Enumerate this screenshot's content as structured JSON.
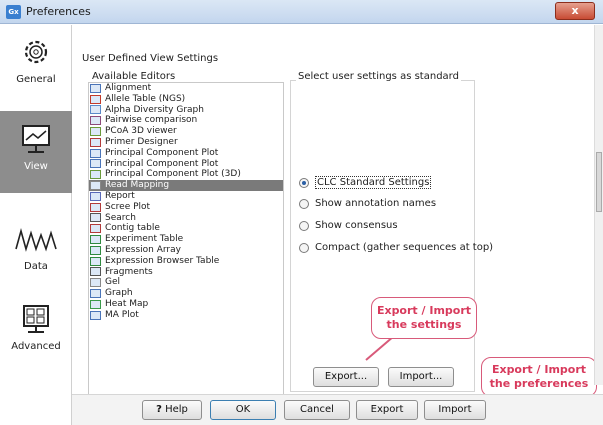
{
  "window": {
    "title": "Preferences",
    "app_icon": "Gx",
    "close_glyph": "x"
  },
  "nav": {
    "items": [
      {
        "label": "General",
        "icon": "gear-icon"
      },
      {
        "label": "View",
        "icon": "monitor-icon",
        "active": true
      },
      {
        "label": "Data",
        "icon": "data-wave-icon"
      },
      {
        "label": "Advanced",
        "icon": "checklist-icon"
      }
    ]
  },
  "content": {
    "section_title": "User Defined View Settings",
    "editors_label": "Available Editors",
    "editors": [
      "Alignment",
      "Allele Table (NGS)",
      "Alpha Diversity Graph",
      "Pairwise comparison",
      "PCoA 3D viewer",
      "Primer Designer",
      "Principal Component Plot",
      "Principal Component Plot",
      "Principal Component Plot (3D)",
      "Read Mapping",
      "Report",
      "Scree Plot",
      "Search",
      "Contig table",
      "Experiment Table",
      "Expression Array",
      "Expression Browser Table",
      "Fragments",
      "Gel",
      "Graph",
      "Heat Map",
      "MA Plot"
    ],
    "selected_editor_index": 9,
    "settings_title": "Select user settings as standard",
    "options": [
      {
        "label": "CLC Standard Settings",
        "checked": true
      },
      {
        "label": "Show annotation names",
        "checked": false
      },
      {
        "label": "Show consensus",
        "checked": false
      },
      {
        "label": "Compact (gather sequences at top)",
        "checked": false
      }
    ],
    "export_label": "Export...",
    "import_label": "Import..."
  },
  "callouts": {
    "settings": "Export / Import\nthe settings",
    "preferences": "Export / Import\nthe preferences"
  },
  "footer": {
    "help_label": "Help",
    "help_glyph": "?",
    "ok_label": "OK",
    "cancel_label": "Cancel",
    "export_label": "Export",
    "import_label": "Import"
  },
  "colors": {
    "callout": "#d83a5c",
    "selection": "#7a7a7a",
    "nav_active": "#8d8d8d"
  }
}
